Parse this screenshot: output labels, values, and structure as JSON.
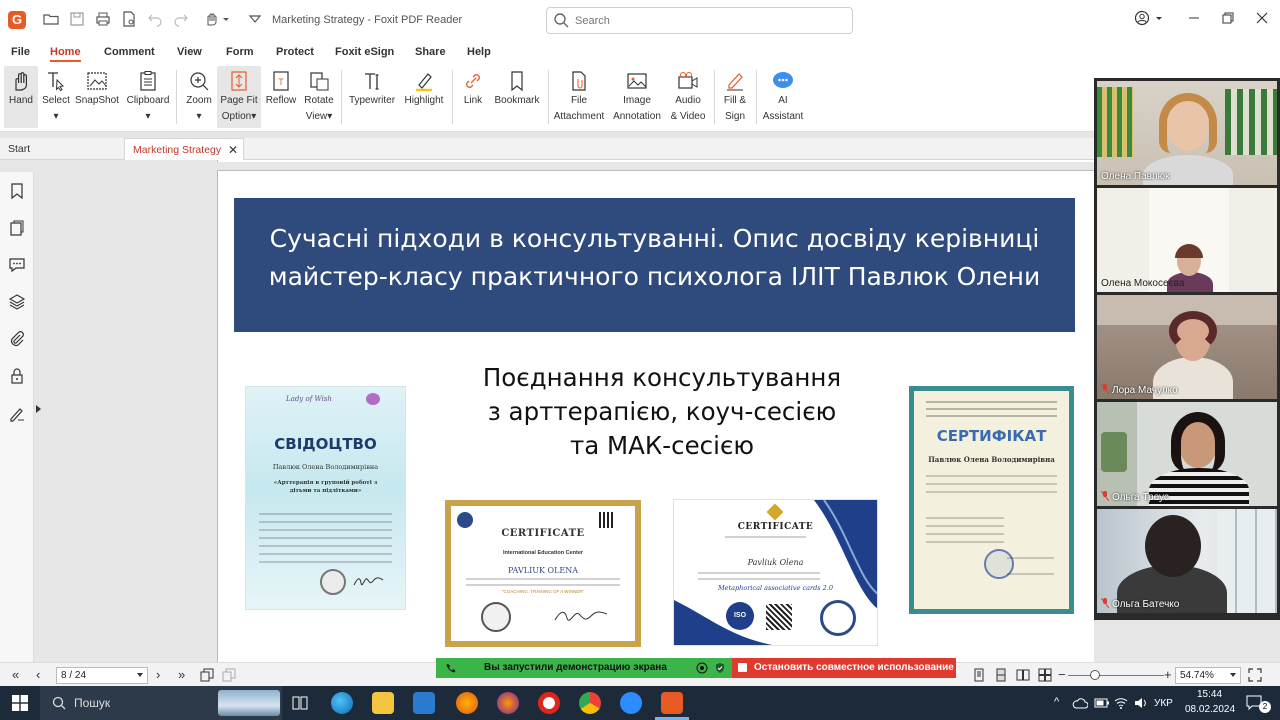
{
  "app": {
    "title": "Marketing Strategy - Foxit PDF Reader",
    "logo_letter": "G",
    "search_placeholder": "Search"
  },
  "menu": [
    "File",
    "Home",
    "Comment",
    "View",
    "Form",
    "Protect",
    "Foxit eSign",
    "Share",
    "Help"
  ],
  "menu_active": "Home",
  "ribbon": [
    {
      "id": "hand",
      "label": "Hand",
      "icon": "hand-icon"
    },
    {
      "id": "select",
      "label": "Select",
      "icon": "select-icon"
    },
    {
      "id": "snapshot",
      "label": "SnapShot",
      "icon": "snapshot-icon"
    },
    {
      "id": "clipboard",
      "label": "Clipboard",
      "icon": "clipboard-icon"
    },
    {
      "id": "zoom",
      "label": "Zoom",
      "icon": "zoom-icon"
    },
    {
      "id": "pagefit",
      "label": "Page Fit",
      "label2": "Option",
      "icon": "page-fit-icon"
    },
    {
      "id": "reflow",
      "label": "Reflow",
      "icon": "reflow-icon"
    },
    {
      "id": "rotate",
      "label": "Rotate",
      "label2": "View",
      "icon": "rotate-icon"
    },
    {
      "id": "typewriter",
      "label": "Typewriter",
      "icon": "typewriter-icon"
    },
    {
      "id": "highlight",
      "label": "Highlight",
      "icon": "highlight-icon"
    },
    {
      "id": "link",
      "label": "Link",
      "icon": "link-icon"
    },
    {
      "id": "bookmark",
      "label": "Bookmark",
      "icon": "bookmark-icon"
    },
    {
      "id": "fileattach",
      "label": "File",
      "label2": "Attachment",
      "icon": "file-attachment-icon"
    },
    {
      "id": "imageannot",
      "label": "Image",
      "label2": "Annotation",
      "icon": "image-annotation-icon"
    },
    {
      "id": "audiovideo",
      "label": "Audio",
      "label2": "& Video",
      "icon": "audio-video-icon"
    },
    {
      "id": "fillsign",
      "label": "Fill &",
      "label2": "Sign",
      "icon": "fill-sign-icon"
    },
    {
      "id": "ai",
      "label": "AI",
      "label2": "Assistant",
      "icon": "ai-assistant-icon"
    }
  ],
  "tabs": {
    "start": "Start",
    "doc": "Marketing Strategy"
  },
  "slide": {
    "banner_line1": "Сучасні підходи в консультуванні. Опис досвіду керівниці",
    "banner_line2": "майстер-класу практичного психолога ІЛІТ Павлюк  Олени",
    "heading_line1": "Поєднання консультування",
    "heading_line2": "з арттерапією, коуч-сесією",
    "heading_line3": "та МАК-сесією",
    "cert_left_title": "СВІДОЦТВО",
    "cert_left_name": "Павлюк Олена Володимирівна",
    "cert_left_sub": "«Арттерапія в груповій роботі з дітьми та підлітками»",
    "cert_right_title": "СЕРТИФІКАТ",
    "cert_right_name": "Павлюк Олена Володимирівна",
    "cert_gold_title": "CERTIFICATE",
    "cert_gold_org": "International Education Center",
    "cert_gold_name": "PAVLIUK OLENA",
    "cert_gold_course": "\"COACHING. TRAINING OF A WINNER\"",
    "cert_blue_title": "CERTIFICATE",
    "cert_blue_name": "Pavliuk Olena",
    "cert_blue_course": "Metaphorical associative cards 2.0",
    "cert_blue_badge": "ISO"
  },
  "participants": [
    {
      "name": "Олена Павлюк",
      "muted": false
    },
    {
      "name": "Олена Мокосеєва",
      "muted": false
    },
    {
      "name": "Лора Мачулко",
      "muted": true
    },
    {
      "name": "Ольга Треус",
      "muted": true
    },
    {
      "name": "Ольга Батечко",
      "muted": true
    }
  ],
  "status": {
    "page": "8 / 24",
    "zoom": "54.74%",
    "share_msg": "Вы запустили демонстрацию экрана",
    "stop_share": "Остановить совместное использование"
  },
  "taskbar": {
    "search": "Пошук",
    "lang": "УКР",
    "time": "15:44",
    "date": "08.02.2024",
    "notifications": "2"
  },
  "colors": {
    "accent": "#e95b25",
    "banner": "#2f4a7d",
    "share_green": "#3bb54a",
    "share_red": "#e03a2f"
  }
}
